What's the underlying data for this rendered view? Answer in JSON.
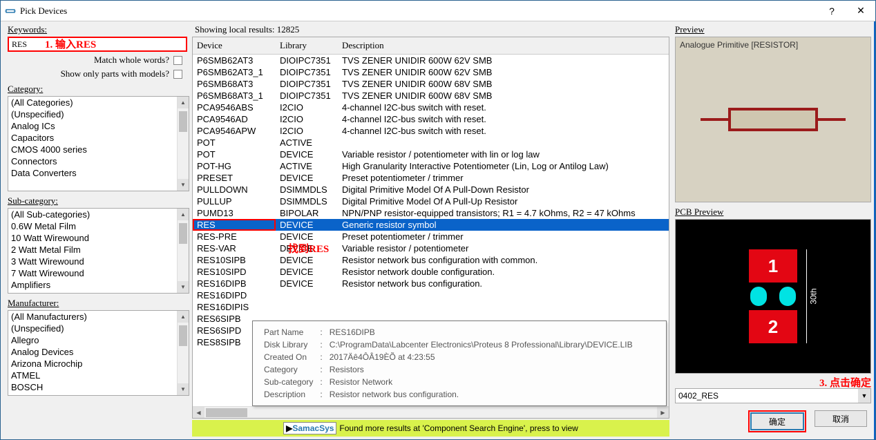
{
  "window": {
    "title": "Pick Devices"
  },
  "left": {
    "keywords_label": "Keywords:",
    "keywords_value": "RES",
    "match_whole": "Match whole words?",
    "only_models": "Show only parts with models?",
    "category_label": "Category:",
    "categories": [
      "(All Categories)",
      "(Unspecified)",
      "Analog ICs",
      "Capacitors",
      "CMOS 4000 series",
      "Connectors",
      "Data Converters"
    ],
    "subcat_label": "Sub-category:",
    "subcats": [
      "(All Sub-categories)",
      "0.6W Metal Film",
      "10 Watt Wirewound",
      "2 Watt Metal Film",
      "3 Watt Wirewound",
      "7 Watt Wirewound",
      "Amplifiers"
    ],
    "manuf_label": "Manufacturer:",
    "manufs": [
      "(All Manufacturers)",
      "(Unspecified)",
      "Allegro",
      "Analog Devices",
      "Arizona Microchip",
      "ATMEL",
      "BOSCH"
    ]
  },
  "mid": {
    "showing": "Showing local results: 12825",
    "cols": {
      "device": "Device",
      "library": "Library",
      "desc": "Description"
    },
    "rows": [
      {
        "d": "P6SMB62AT3",
        "l": "DIOIPC7351",
        "x": "TVS ZENER UNIDIR 600W 62V SMB"
      },
      {
        "d": "P6SMB62AT3_1",
        "l": "DIOIPC7351",
        "x": "TVS ZENER UNIDIR 600W 62V SMB"
      },
      {
        "d": "P6SMB68AT3",
        "l": "DIOIPC7351",
        "x": "TVS ZENER UNIDIR 600W 68V SMB"
      },
      {
        "d": "P6SMB68AT3_1",
        "l": "DIOIPC7351",
        "x": "TVS ZENER UNIDIR 600W 68V SMB"
      },
      {
        "d": "PCA9546ABS",
        "l": "I2CIO",
        "x": "4-channel I2C-bus switch with reset."
      },
      {
        "d": "PCA9546AD",
        "l": "I2CIO",
        "x": "4-channel I2C-bus switch with reset."
      },
      {
        "d": "PCA9546APW",
        "l": "I2CIO",
        "x": "4-channel I2C-bus switch with reset."
      },
      {
        "d": "POT",
        "l": "ACTIVE",
        "x": ""
      },
      {
        "d": "POT",
        "l": "DEVICE",
        "x": "Variable resistor / potentiometer with lin or log law"
      },
      {
        "d": "POT-HG",
        "l": "ACTIVE",
        "x": "High Granularity Interactive Potentiometer (Lin, Log or Antilog Law)"
      },
      {
        "d": "PRESET",
        "l": "DEVICE",
        "x": "Preset potentiometer / trimmer"
      },
      {
        "d": "PULLDOWN",
        "l": "DSIMMDLS",
        "x": "Digital Primitive Model Of A Pull-Down Resistor"
      },
      {
        "d": "PULLUP",
        "l": "DSIMMDLS",
        "x": "Digital Primitive Model Of A Pull-Up Resistor"
      },
      {
        "d": "PUMD13",
        "l": "BIPOLAR",
        "x": "NPN/PNP resistor-equipped transistors; R1 = 4.7 kOhms, R2 = 47 kOhms"
      },
      {
        "d": "RES",
        "l": "DEVICE",
        "x": "Generic resistor symbol",
        "sel": true
      },
      {
        "d": "RES-PRE",
        "l": "DEVICE",
        "x": "Preset potentiometer / trimmer"
      },
      {
        "d": "RES-VAR",
        "l": "DEVICE",
        "x": "Variable resistor / potentiometer"
      },
      {
        "d": "RES10SIPB",
        "l": "DEVICE",
        "x": "Resistor network bus configuration with common."
      },
      {
        "d": "RES10SIPD",
        "l": "DEVICE",
        "x": "Resistor network double configuration."
      },
      {
        "d": "RES16DIPB",
        "l": "DEVICE",
        "x": "Resistor network bus configuration."
      },
      {
        "d": "RES16DIPD",
        "l": "",
        "x": ""
      },
      {
        "d": "RES16DIPIS",
        "l": "",
        "x": ""
      },
      {
        "d": "RES6SIPB",
        "l": "",
        "x": ""
      },
      {
        "d": "RES6SIPD",
        "l": "",
        "x": ""
      },
      {
        "d": "RES8SIPB",
        "l": "",
        "x": ""
      }
    ],
    "tooltip": {
      "PartName_k": "Part Name",
      "PartName_v": "RES16DIPB",
      "DiskLib_k": "Disk Library",
      "DiskLib_v": "C:\\ProgramData\\Labcenter Electronics\\Proteus 8 Professional\\Library\\DEVICE.LIB",
      "Created_k": "Created On",
      "Created_v": "2017Äê4ÔÂ19ÈÕ at 4:23:55",
      "Cat_k": "Category",
      "Cat_v": "Resistors",
      "Sub_k": "Sub-category",
      "Sub_v": "Resistor Network",
      "Desc_k": "Description",
      "Desc_v": "Resistor network bus configuration."
    },
    "samacsys": "Found more results at 'Component Search Engine', press to view",
    "samacsys_logo": "SamacSys"
  },
  "right": {
    "preview_label": "Preview",
    "preview_caption": "Analogue Primitive [RESISTOR]",
    "pcb_label": "PCB Preview",
    "pad1": "1",
    "pad2": "2",
    "dim": "30th",
    "footprint": "0402_RES",
    "ok": "确定",
    "cancel": "取消"
  },
  "annotations": {
    "step1": "1. 输入RES",
    "step2": "找到RES",
    "step3": "3. 点击确定"
  }
}
